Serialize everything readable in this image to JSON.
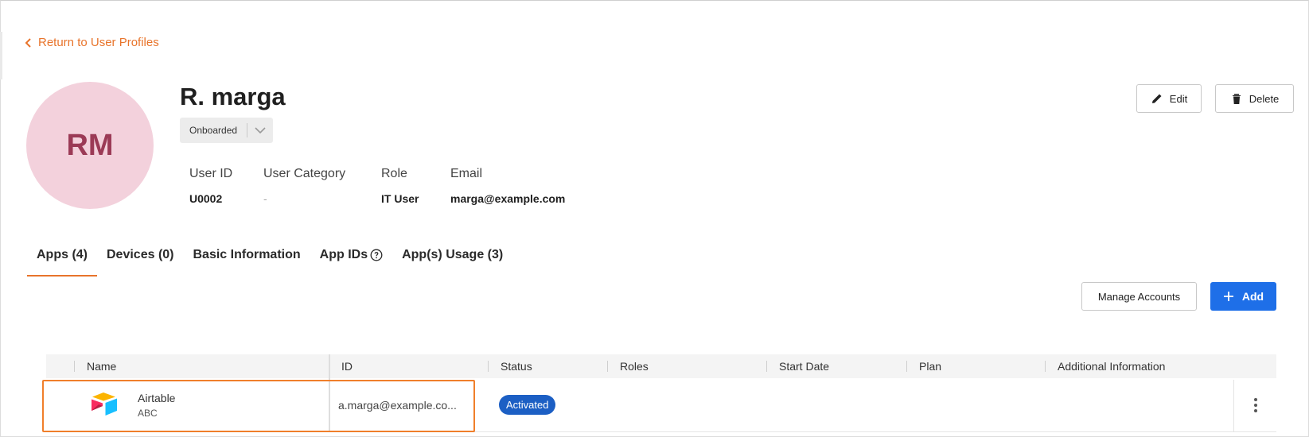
{
  "navigation": {
    "back_label": "Return to User Profiles"
  },
  "profile": {
    "initials": "RM",
    "name": "R. marga",
    "status": "Onboarded",
    "avatar_color": "#f3d1dc",
    "initials_color": "#9b3a56"
  },
  "details": {
    "user_id_label": "User ID",
    "user_id": "U0002",
    "category_label": "User Category",
    "category": "-",
    "role_label": "Role",
    "role": "IT User",
    "email_label": "Email",
    "email": "marga@example.com"
  },
  "actions": {
    "edit_label": "Edit",
    "delete_label": "Delete"
  },
  "tabs": [
    {
      "label": "Apps (4)",
      "active": true
    },
    {
      "label": "Devices (0)",
      "active": false
    },
    {
      "label": "Basic Information",
      "active": false
    },
    {
      "label": "App IDs",
      "active": false,
      "icon": "help-circle-icon"
    },
    {
      "label": "App(s) Usage (3)",
      "active": false
    }
  ],
  "toolbar": {
    "manage_accounts_label": "Manage Accounts",
    "add_label": "Add"
  },
  "table": {
    "columns": [
      "Name",
      "ID",
      "Status",
      "Roles",
      "Start Date",
      "Plan",
      "Additional Information"
    ],
    "rows": [
      {
        "app_name": "Airtable",
        "app_sub": "ABC",
        "app_icon": "airtable-logo",
        "id": "a.marga@example.co...",
        "status": "Activated",
        "roles": "",
        "start_date": "",
        "plan": "",
        "additional_information": ""
      }
    ]
  },
  "colors": {
    "accent": "#e8742b",
    "primary": "#1e6fe8",
    "badge": "#1c5fc4",
    "highlight_border": "#f07f2b"
  }
}
